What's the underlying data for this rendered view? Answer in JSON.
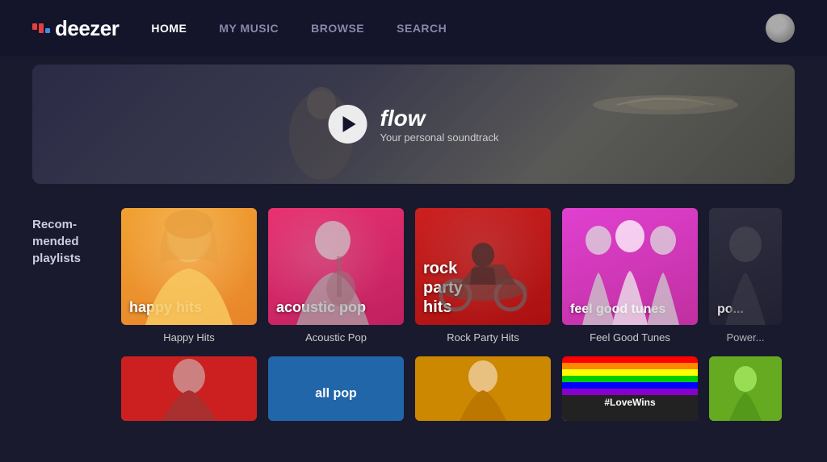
{
  "nav": {
    "logo_text": "deezer",
    "links": [
      {
        "label": "HOME",
        "active": true
      },
      {
        "label": "MY MUSIC",
        "active": false
      },
      {
        "label": "BROWSE",
        "active": false
      },
      {
        "label": "SEARCH",
        "active": false
      }
    ]
  },
  "hero": {
    "title": "flow",
    "subtitle": "Your personal soundtrack",
    "play_label": "Play"
  },
  "recommended": {
    "section_label": "Recom-\nmended\nplaylists",
    "playlists": [
      {
        "id": "happy",
        "overlay_label": "happy hits",
        "title": "Happy Hits"
      },
      {
        "id": "acoustic",
        "overlay_label": "acoustic pop",
        "title": "Acoustic Pop"
      },
      {
        "id": "rock",
        "overlay_label": "rock\nparty\nhits",
        "title": "Rock Party Hits"
      },
      {
        "id": "feelgood",
        "overlay_label": "feel good tunes",
        "title": "Feel Good Tunes"
      },
      {
        "id": "power",
        "overlay_label": "po...",
        "title": "Power..."
      }
    ]
  },
  "bottom_row": {
    "items": [
      {
        "label": "",
        "type": "red-person"
      },
      {
        "label": "all pop",
        "type": "blue"
      },
      {
        "label": "",
        "type": "orange-person"
      },
      {
        "label": "#LoveWins",
        "type": "rainbow"
      },
      {
        "label": "",
        "type": "green"
      }
    ]
  }
}
